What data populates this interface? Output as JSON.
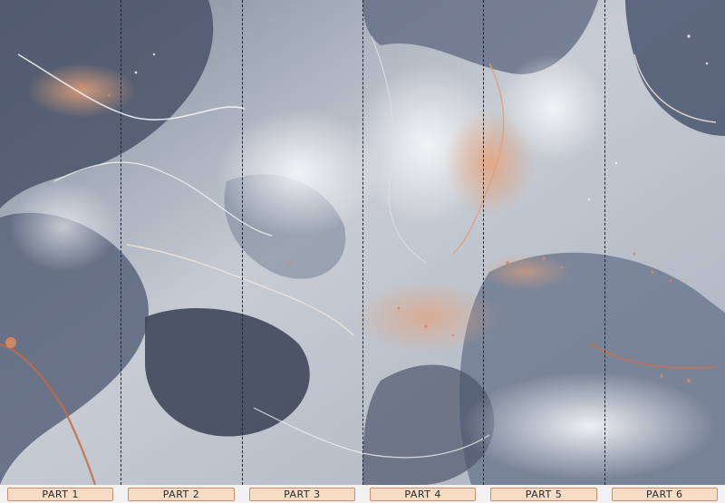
{
  "mural": {
    "description_colors": {
      "base": "#c9ced6",
      "slate": "#5f6b82",
      "deep": "#3b4458",
      "copper": "#d88a63",
      "pale": "#eef0f3"
    }
  },
  "parts": [
    {
      "label": "PART 1"
    },
    {
      "label": "PART 2"
    },
    {
      "label": "PART 3"
    },
    {
      "label": "PART 4"
    },
    {
      "label": "PART 5"
    },
    {
      "label": "PART 6"
    }
  ],
  "colors": {
    "label_fill": "#f7dcc6",
    "label_border": "#c88f6e",
    "divider": "#1e2430"
  }
}
